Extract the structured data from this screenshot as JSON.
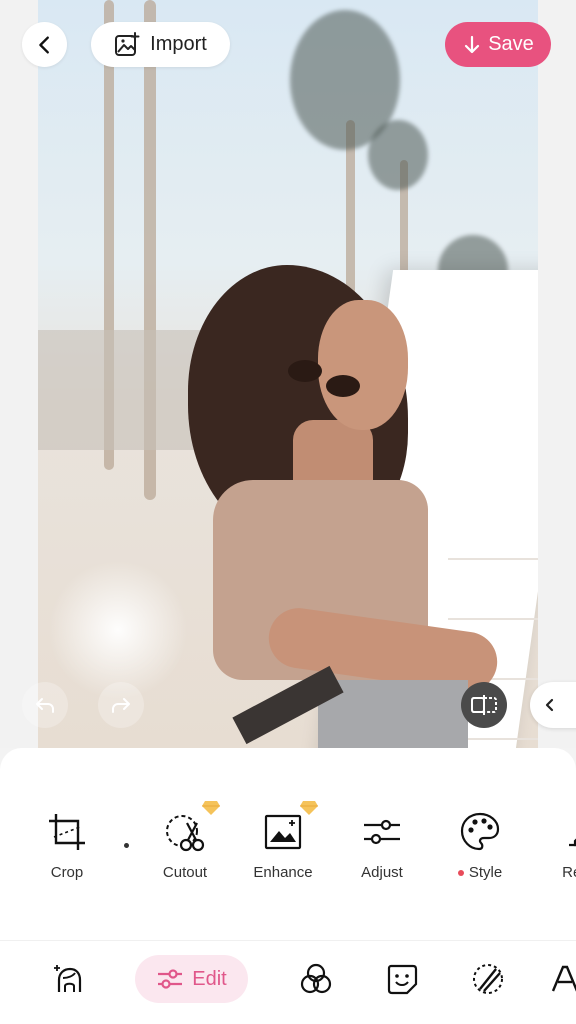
{
  "header": {
    "import_label": "Import",
    "save_label": "Save"
  },
  "tools": [
    {
      "label": "Crop",
      "icon": "crop-icon",
      "premium": false
    },
    {
      "label": "Cutout",
      "icon": "cutout-scissors-icon",
      "premium": true
    },
    {
      "label": "Enhance",
      "icon": "enhance-image-icon",
      "premium": true
    },
    {
      "label": "Adjust",
      "icon": "adjust-sliders-icon",
      "premium": false
    },
    {
      "label": "Style",
      "icon": "palette-icon",
      "premium": false,
      "new_dot": true
    },
    {
      "label": "Rem",
      "icon": "eraser-icon",
      "premium": false
    }
  ],
  "nav": {
    "edit_label": "Edit",
    "items": [
      "retouch-face-icon",
      "edit-sliders-icon",
      "filters-circles-icon",
      "sticker-icon",
      "effects-icon",
      "text-icon"
    ]
  },
  "colors": {
    "accent": "#e8527f",
    "edit_tab_bg": "#fbe7ef",
    "premium_gem": "#f5c35a",
    "style_dot": "#e84b5a"
  }
}
